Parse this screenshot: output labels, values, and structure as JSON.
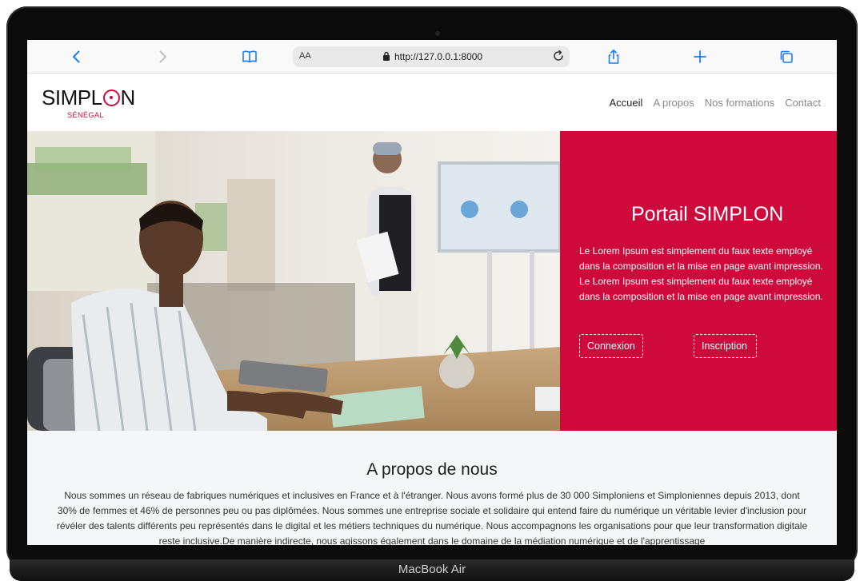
{
  "device": {
    "label": "MacBook Air"
  },
  "browser": {
    "text_size_label": "AA",
    "url": "http://127.0.0.1:8000",
    "icons": [
      "back-icon",
      "forward-icon",
      "bookmarks-icon",
      "lock-icon",
      "reload-icon",
      "share-icon",
      "new-tab-icon",
      "tabs-icon"
    ]
  },
  "site": {
    "logo": {
      "name": "SIMPLON",
      "subtitle": "SÉNÉGAL"
    },
    "nav": [
      {
        "label": "Accueil",
        "active": true
      },
      {
        "label": "A propos",
        "active": false
      },
      {
        "label": "Nos formations",
        "active": false
      },
      {
        "label": "Contact",
        "active": false
      }
    ],
    "hero": {
      "title": "Portail SIMPLON",
      "text": "Le Lorem Ipsum est simplement du faux texte employé dans la composition et la mise en page avant impression. Le Lorem Ipsum est simplement du faux texte employé dans la composition et la mise en page avant impression.",
      "login_label": "Connexion",
      "signup_label": "Inscription",
      "accent_color": "#cd0a3b"
    },
    "about": {
      "title": "A propos de nous",
      "text": "Nous sommes un réseau de fabriques numériques et inclusives en France et à l'étranger. Nous avons formé plus de 30 000 Simploniens et Simploniennes depuis 2013, dont 30% de femmes et 46% de personnes peu ou pas diplômées. Nous sommes une entreprise sociale et solidaire qui entend faire du numérique un véritable levier d'inclusion pour révéler des talents différents peu représentés dans le digital et les métiers techniques du numérique. Nous accompagnons les organisations pour que leur transformation digitale reste inclusive.De manière indirecte, nous agissons également dans le domaine de la médiation numérique et de l'apprentissage"
    }
  }
}
